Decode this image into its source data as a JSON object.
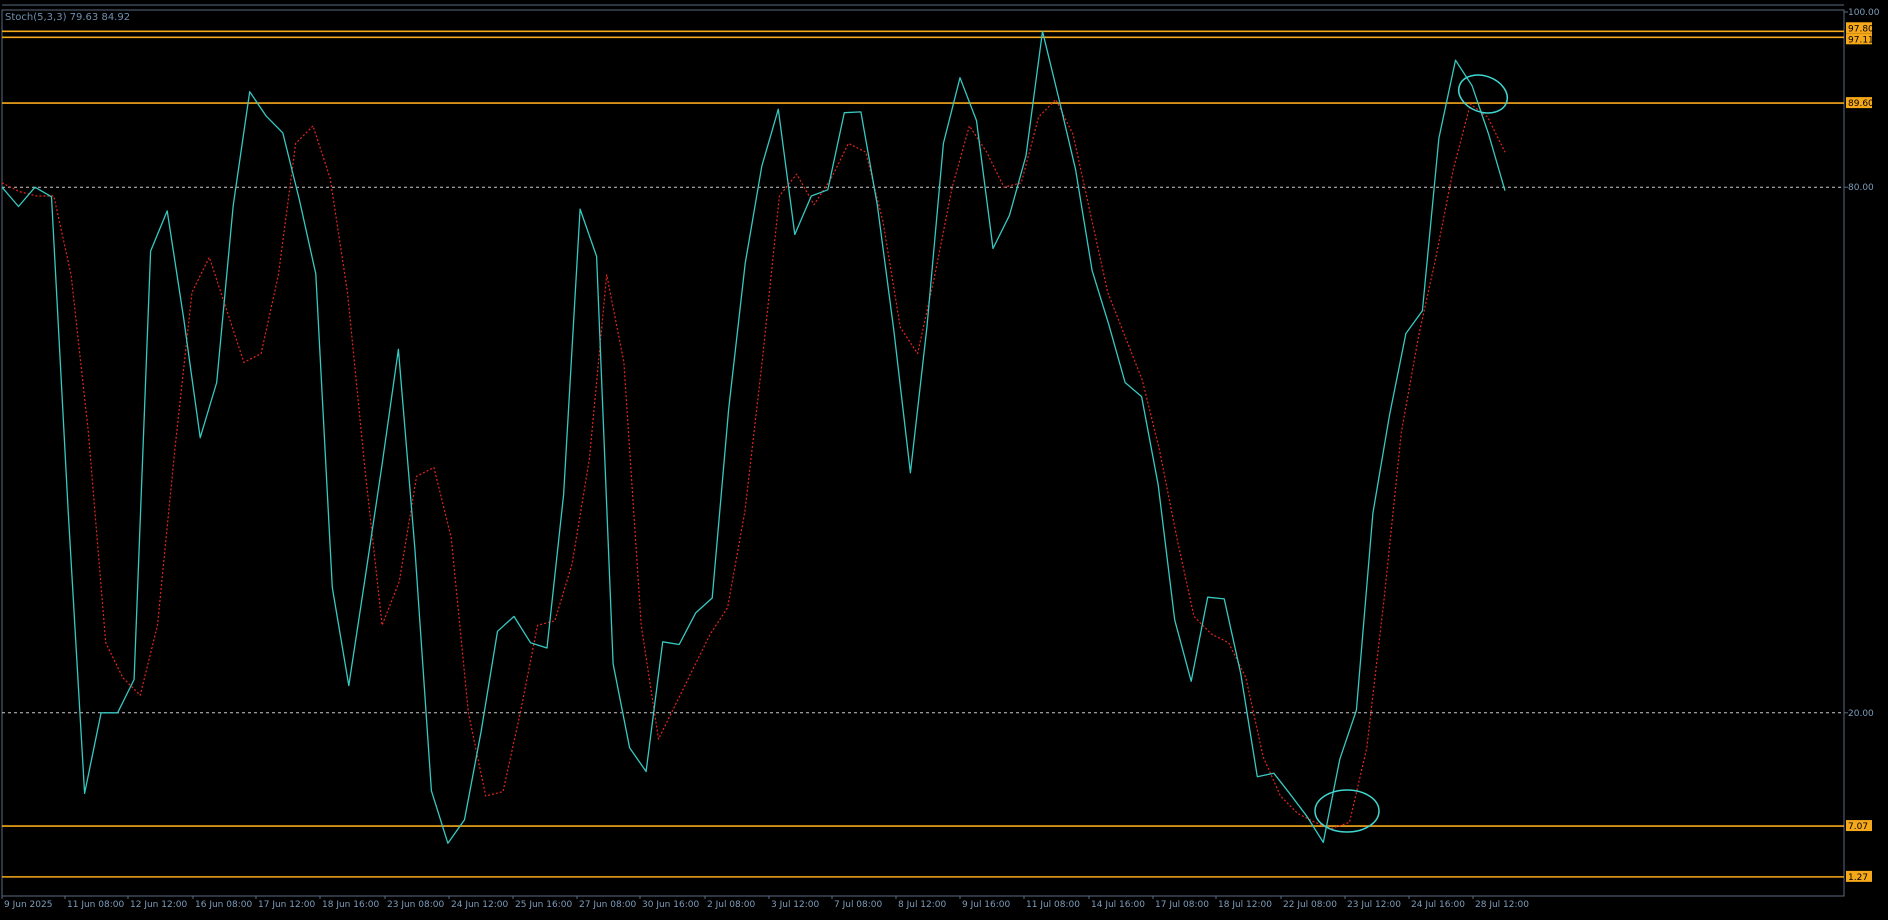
{
  "indicator": {
    "name": "Stoch(5,3,3)",
    "main_value": "79.63",
    "signal_value": "84.92"
  },
  "colors": {
    "background": "#000000",
    "frame": "#5a6b80",
    "main_line": "#36c9c2",
    "signal_line": "#e3261f",
    "level_line": "#f6a81b",
    "dotted_level": "#c9c9c9",
    "axis_text": "#7d9dbb",
    "annotation": "#3fd7d0"
  },
  "chart_data": {
    "type": "line",
    "title": "Stoch(5,3,3) 79.63 84.92",
    "ylim": [
      0,
      100
    ],
    "grid": false,
    "x_tick_labels": [
      "9 Jun 2025",
      "11 Jun 08:00",
      "12 Jun 12:00",
      "16 Jun 08:00",
      "17 Jun 12:00",
      "18 Jun 16:00",
      "23 Jun 08:00",
      "24 Jun 12:00",
      "25 Jun 16:00",
      "27 Jun 08:00",
      "30 Jun 16:00",
      "2 Jul 08:00",
      "3 Jul 12:00",
      "7 Jul 08:00",
      "8 Jul 12:00",
      "9 Jul 16:00",
      "11 Jul 08:00",
      "14 Jul 16:00",
      "17 Jul 08:00",
      "18 Jul 12:00",
      "22 Jul 08:00",
      "23 Jul 12:00",
      "24 Jul 16:00",
      "28 Jul 12:00"
    ],
    "y_tick_labels": [
      "100.00",
      "80.00",
      "20.00"
    ],
    "dotted_levels": [
      80,
      20
    ],
    "horizontal_levels": [
      {
        "value": 97.8,
        "label": "97.80"
      },
      {
        "value": 97.11,
        "label": "97.11"
      },
      {
        "value": 89.6,
        "label": "89.60"
      },
      {
        "value": 7.07,
        "label": "7.07"
      },
      {
        "value": 1.27,
        "label": "1.27"
      }
    ],
    "series": [
      {
        "name": "Main",
        "style": "solid",
        "values": [
          80.0,
          77.8,
          80.0,
          78.9,
          43.2,
          10.8,
          20.0,
          20.0,
          23.8,
          72.7,
          77.3,
          65.0,
          51.4,
          57.7,
          77.9,
          90.9,
          88.1,
          86.2,
          78.6,
          70.1,
          34.3,
          23.1,
          35.6,
          48.2,
          61.5,
          38.7,
          11.1,
          5.1,
          7.8,
          17.8,
          29.3,
          31.0,
          28.0,
          27.4,
          44.9,
          77.5,
          72.1,
          25.6,
          16.0,
          13.3,
          28.1,
          27.8,
          31.4,
          33.1,
          54.7,
          71.3,
          82.4,
          88.9,
          74.6,
          79.0,
          79.7,
          88.5,
          88.6,
          77.9,
          63.6,
          47.4,
          64.0,
          85.0,
          92.5,
          87.6,
          73.0,
          76.8,
          83.6,
          97.8,
          90.0,
          82.0,
          70.5,
          64.4,
          57.7,
          56.1,
          46.0,
          30.6,
          23.6,
          33.2,
          33.0,
          24.5,
          12.7,
          13.1,
          10.7,
          8.2,
          5.2,
          14.7,
          20.3,
          42.8,
          53.9,
          63.3,
          65.9,
          85.6,
          94.5,
          91.6,
          86.1,
          79.6
        ]
      },
      {
        "name": "Signal",
        "style": "dotted",
        "values": [
          80.5,
          79.5,
          79.0,
          79.0,
          70.0,
          52.0,
          28.0,
          24.0,
          22.0,
          30.0,
          50.0,
          68.0,
          72.0,
          66.0,
          60.0,
          61.0,
          70.0,
          85.0,
          87.0,
          81.0,
          68.0,
          48.0,
          30.0,
          35.0,
          47.0,
          48.0,
          40.0,
          20.0,
          10.5,
          11.0,
          20.0,
          30.0,
          30.5,
          37.0,
          49.0,
          70.0,
          60.0,
          30.0,
          17.0,
          21.0,
          25.0,
          29.0,
          32.0,
          43.0,
          60.0,
          79.0,
          81.5,
          78.0,
          81.0,
          85.0,
          84.0,
          76.0,
          64.0,
          61.0,
          70.0,
          80.0,
          87.0,
          84.0,
          80.0,
          80.5,
          88.0,
          90.0,
          86.0,
          77.0,
          68.0,
          63.0,
          58.0,
          50.0,
          40.0,
          31.0,
          29.0,
          28.0,
          24.0,
          15.0,
          10.5,
          8.5,
          7.5,
          6.8,
          7.5,
          16.0,
          33.0,
          52.0,
          63.0,
          72.0,
          82.0,
          89.5,
          88.0,
          84.0
        ]
      }
    ]
  }
}
